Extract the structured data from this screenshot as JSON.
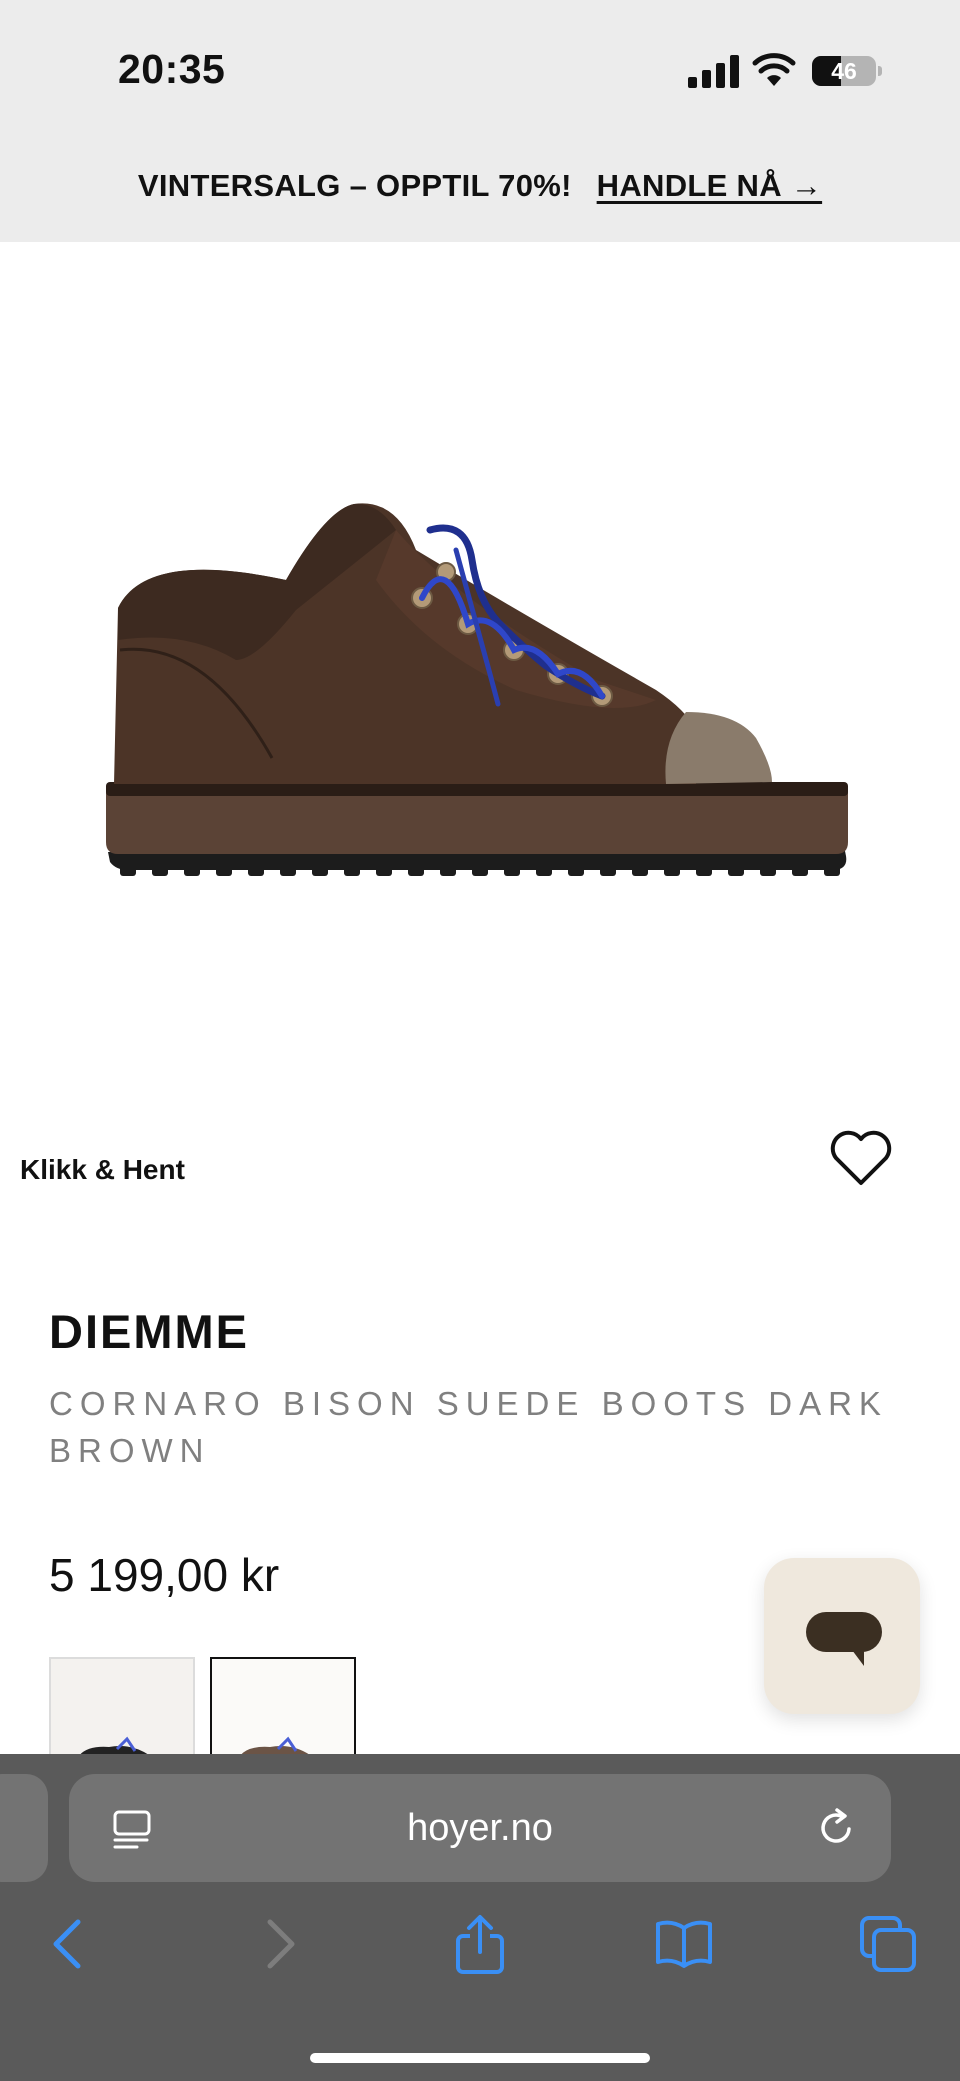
{
  "status_bar": {
    "time": "20:35",
    "battery_level": "46",
    "battery_fraction": 0.46,
    "icons": [
      "cellular-signal-icon",
      "wifi-icon",
      "battery-icon"
    ]
  },
  "promo_banner": {
    "text": "VINTERSALG – OPPTIL 70%!",
    "cta": "HANDLE NÅ →"
  },
  "product": {
    "pickup_label": "Klikk & Hent",
    "brand": "DIEMME",
    "name": "CORNARO BISON SUEDE BOOTS DARK BROWN",
    "price": "5 199,00 kr",
    "image_description_icon": "shoe-image",
    "thumbnails_count": 2,
    "selected_thumbnail": 2
  },
  "browser": {
    "url": "hoyer.no",
    "toolbar": [
      "back-icon",
      "forward-icon",
      "share-icon",
      "bookmarks-icon",
      "tabs-icon"
    ]
  },
  "colors": {
    "banner_bg": "#ececec",
    "brand_text": "#111111",
    "name_text": "#808080",
    "chat_bg": "#efe8dd",
    "chat_icon": "#3b2f22",
    "browser_bg": "#5a5a5a",
    "browser_accent": "#3a8ff5"
  }
}
